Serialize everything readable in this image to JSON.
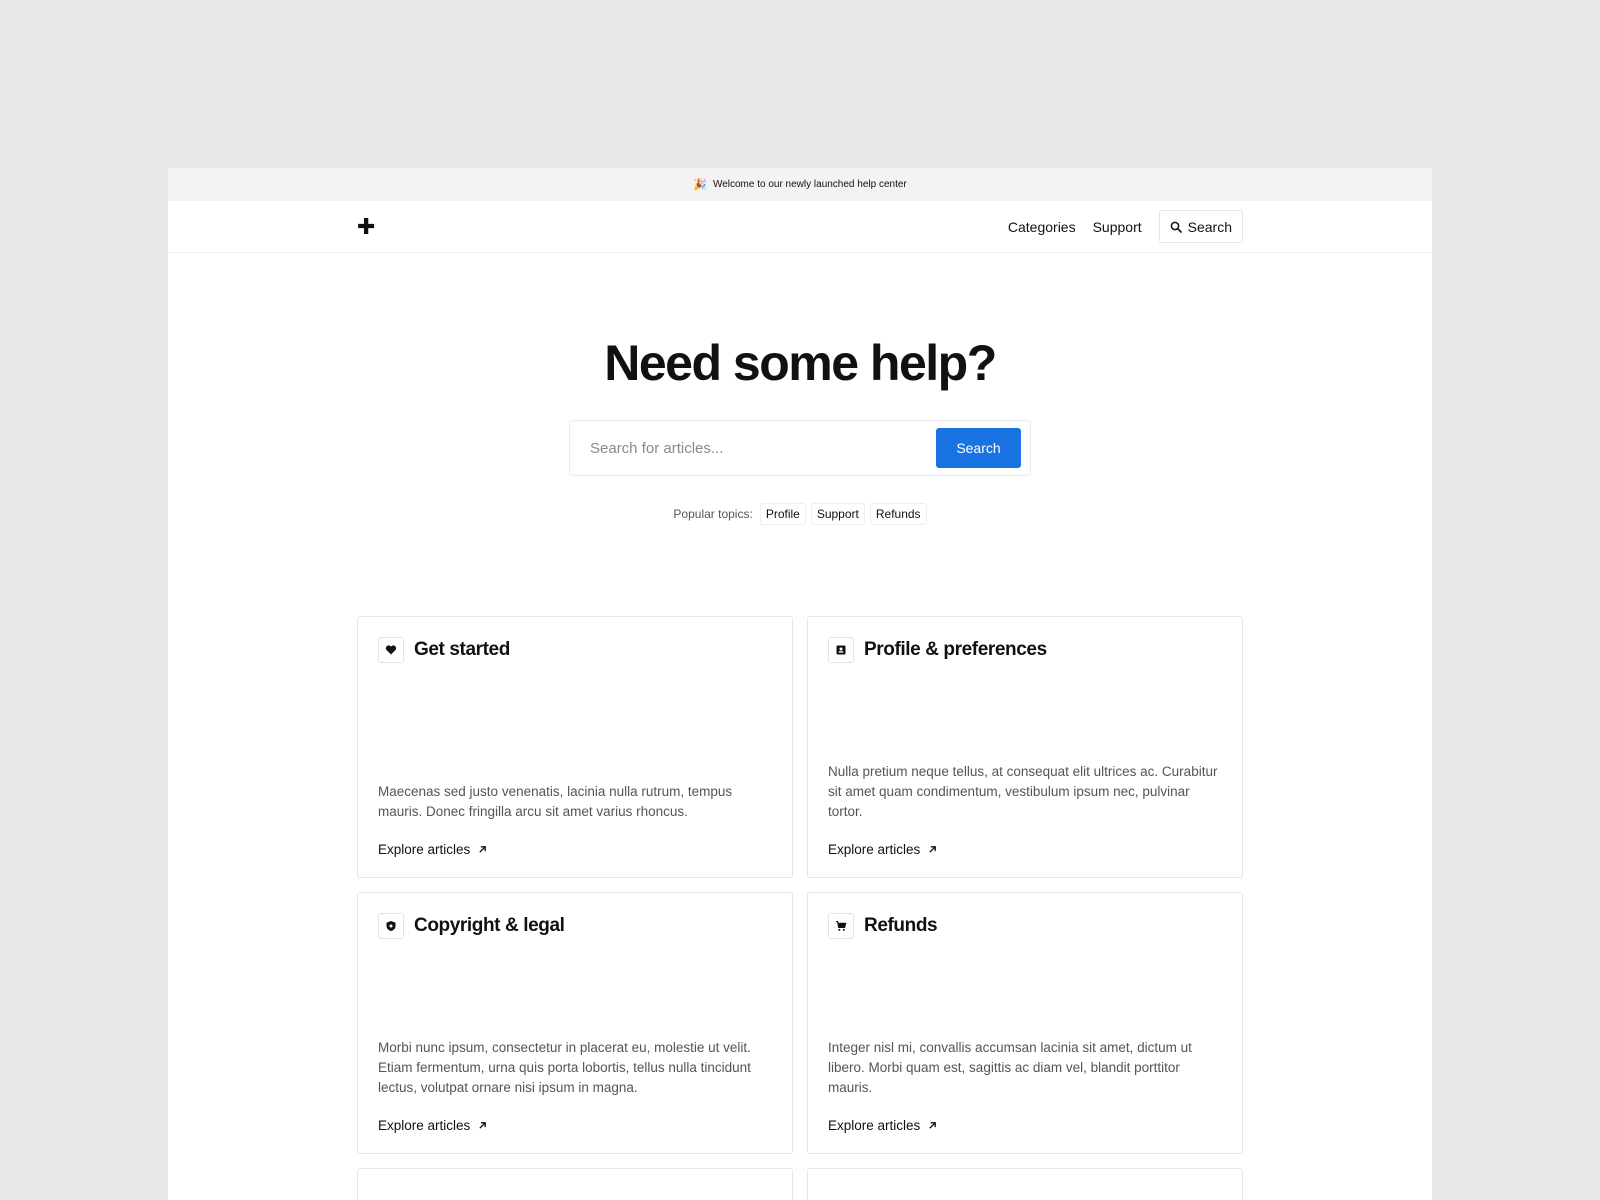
{
  "announcement": {
    "icon": "party-popper-icon",
    "text": "Welcome to our newly launched help center"
  },
  "nav": {
    "logo": "✚",
    "links": [
      "Categories",
      "Support"
    ],
    "search_label": "Search"
  },
  "hero": {
    "title": "Need some help?",
    "search_placeholder": "Search for articles...",
    "search_button": "Search",
    "popular_label": "Popular topics:",
    "topics": [
      "Profile",
      "Support",
      "Refunds"
    ]
  },
  "categories": [
    {
      "icon": "heart-icon",
      "title": "Get started",
      "description": "Maecenas sed justo venenatis, lacinia nulla rutrum, tempus mauris. Donec fringilla arcu sit amet varius rhoncus.",
      "link": "Explore articles"
    },
    {
      "icon": "id-card-icon",
      "title": "Profile & preferences",
      "description": "Nulla pretium neque tellus, at consequat elit ultrices ac. Curabitur sit amet quam condimentum, vestibulum ipsum nec, pulvinar tortor.",
      "link": "Explore articles"
    },
    {
      "icon": "shield-icon",
      "title": "Copyright & legal",
      "description": "Morbi nunc ipsum, consectetur in placerat eu, molestie ut velit. Etiam fermentum, urna quis porta lobortis, tellus nulla tincidunt lectus, volutpat ornare nisi ipsum in magna.",
      "link": "Explore articles"
    },
    {
      "icon": "cart-icon",
      "title": "Refunds",
      "description": "Integer nisl mi, convallis accumsan lacinia sit amet, dictum ut libero. Morbi quam est, sagittis ac diam vel, blandit porttitor mauris.",
      "link": "Explore articles"
    }
  ],
  "colors": {
    "accent": "#1a73e3",
    "page_background": "#e7e7e7",
    "announcement_background": "#f3f3f3"
  }
}
